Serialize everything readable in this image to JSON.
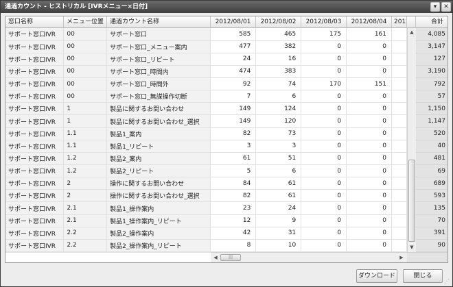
{
  "window": {
    "title": "通過カウント - ヒストリカル [IVRメニュー×日付]",
    "minimize_glyph": "▾",
    "close_glyph": "✕"
  },
  "columns": {
    "window_name": "窓口名称",
    "menu_position": "メニュー位置",
    "count_name": "通過カウント名称",
    "dates": [
      "2012/08/01",
      "2012/08/02",
      "2012/08/03",
      "2012/08/04",
      "2012/0"
    ],
    "total": "合計"
  },
  "rows": [
    {
      "window": "サポート窓口IVR",
      "pos": "00",
      "name": "サポート窓口",
      "v": [
        "585",
        "465",
        "175",
        "161"
      ],
      "total": "4,085"
    },
    {
      "window": "サポート窓口IVR",
      "pos": "00",
      "name": "サポート窓口_メニュー案内",
      "v": [
        "477",
        "382",
        "0",
        "0"
      ],
      "total": "3,147"
    },
    {
      "window": "サポート窓口IVR",
      "pos": "00",
      "name": "サポート窓口_リピート",
      "v": [
        "24",
        "16",
        "0",
        "0"
      ],
      "total": "127"
    },
    {
      "window": "サポート窓口IVR",
      "pos": "00",
      "name": "サポート窓口_時間内",
      "v": [
        "474",
        "383",
        "0",
        "0"
      ],
      "total": "3,190"
    },
    {
      "window": "サポート窓口IVR",
      "pos": "00",
      "name": "サポート窓口_時間外",
      "v": [
        "92",
        "74",
        "170",
        "151"
      ],
      "total": "792"
    },
    {
      "window": "サポート窓口IVR",
      "pos": "00",
      "name": "サポート窓口_無謀操作切断",
      "v": [
        "7",
        "6",
        "0",
        "0"
      ],
      "total": "57"
    },
    {
      "window": "サポート窓口IVR",
      "pos": "1",
      "name": "製品に関するお問い合わせ",
      "v": [
        "149",
        "124",
        "0",
        "0"
      ],
      "total": "1,150"
    },
    {
      "window": "サポート窓口IVR",
      "pos": "1",
      "name": "製品に関するお問い合わせ_選択",
      "v": [
        "149",
        "120",
        "0",
        "0"
      ],
      "total": "1,147"
    },
    {
      "window": "サポート窓口IVR",
      "pos": "1.1",
      "name": "製品1_案内",
      "v": [
        "82",
        "73",
        "0",
        "0"
      ],
      "total": "520"
    },
    {
      "window": "サポート窓口IVR",
      "pos": "1.1",
      "name": "製品1_リピート",
      "v": [
        "3",
        "3",
        "0",
        "0"
      ],
      "total": "40"
    },
    {
      "window": "サポート窓口IVR",
      "pos": "1.2",
      "name": "製品2_案内",
      "v": [
        "61",
        "51",
        "0",
        "0"
      ],
      "total": "481"
    },
    {
      "window": "サポート窓口IVR",
      "pos": "1.2",
      "name": "製品2_リピート",
      "v": [
        "5",
        "6",
        "0",
        "0"
      ],
      "total": "69"
    },
    {
      "window": "サポート窓口IVR",
      "pos": "2",
      "name": "操作に関するお問い合わせ",
      "v": [
        "84",
        "61",
        "0",
        "0"
      ],
      "total": "689"
    },
    {
      "window": "サポート窓口IVR",
      "pos": "2",
      "name": "操作に関するお問い合わせ_選択",
      "v": [
        "82",
        "61",
        "0",
        "0"
      ],
      "total": "593"
    },
    {
      "window": "サポート窓口IVR",
      "pos": "2.1",
      "name": "製品1_操作案内",
      "v": [
        "23",
        "24",
        "0",
        "0"
      ],
      "total": "135"
    },
    {
      "window": "サポート窓口IVR",
      "pos": "2.1",
      "name": "製品1_操作案内_リピート",
      "v": [
        "12",
        "9",
        "0",
        "0"
      ],
      "total": "70"
    },
    {
      "window": "サポート窓口IVR",
      "pos": "2.2",
      "name": "製品2_操作案内",
      "v": [
        "42",
        "31",
        "0",
        "0"
      ],
      "total": "391"
    },
    {
      "window": "サポート窓口IVR",
      "pos": "2.2",
      "name": "製品2_操作案内_リピート",
      "v": [
        "8",
        "10",
        "0",
        "0"
      ],
      "total": "90"
    }
  ],
  "scrollbar": {
    "up_glyph": "▲",
    "down_glyph": "▼",
    "left_glyph": "◀",
    "right_glyph": "▶",
    "thumb_grip": "|||"
  },
  "footer": {
    "download_label": "ダウンロード",
    "close_label": "閉じる",
    "resize_glyph": "⋰"
  }
}
